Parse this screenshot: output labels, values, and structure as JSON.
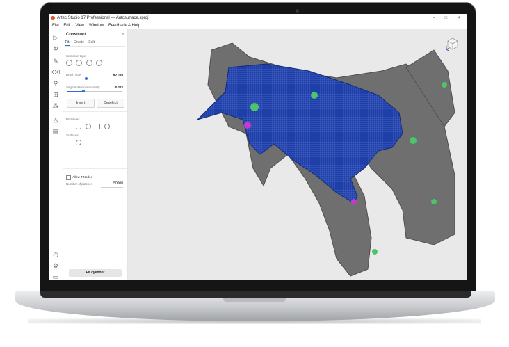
{
  "app": {
    "title": "Artec Studio 17 Professional — Autosurface.sproj",
    "window_controls": "– □ ✕"
  },
  "menu": [
    "File",
    "Edit",
    "View",
    "Window",
    "Feedback & Help"
  ],
  "toolbar": {
    "icons": [
      "play-icon",
      "history-icon",
      "pencil-icon",
      "eraser-icon",
      "brush-icon",
      "grid-icon",
      "pattern-icon",
      "triangle-icon",
      "layers-icon",
      "clock-icon",
      "settings-icon",
      "chat-icon"
    ]
  },
  "panel": {
    "title": "Construct",
    "close": "×",
    "tabs": [
      "Fit",
      "Create",
      "Edit"
    ],
    "active_tab": "Fit",
    "selection_type_label": "Selection type",
    "brush_size_label": "Brush size",
    "brush_size_value": "60 mm",
    "brush_size_fraction": 0.35,
    "segmentation_label": "Segmentation sensitivity",
    "segmentation_value": "0.222",
    "segmentation_fraction": 0.3,
    "invert_label": "Invert",
    "deselect_label": "Deselect",
    "primitives_label": "Primitives",
    "surfaces_label": "Surfaces",
    "allow_t_nodes_label": "Allow T-Nodes",
    "patches_label": "Number of patches",
    "patches_value": "50000",
    "fit_button_label": "Fit cylinder"
  },
  "colors": {
    "mesh_blue": "#1f3fa8",
    "part_gray": "#6f6f6f",
    "accent": "#2b6fd6",
    "marker_green": "#4cc46b",
    "marker_magenta": "#c33ad0"
  }
}
